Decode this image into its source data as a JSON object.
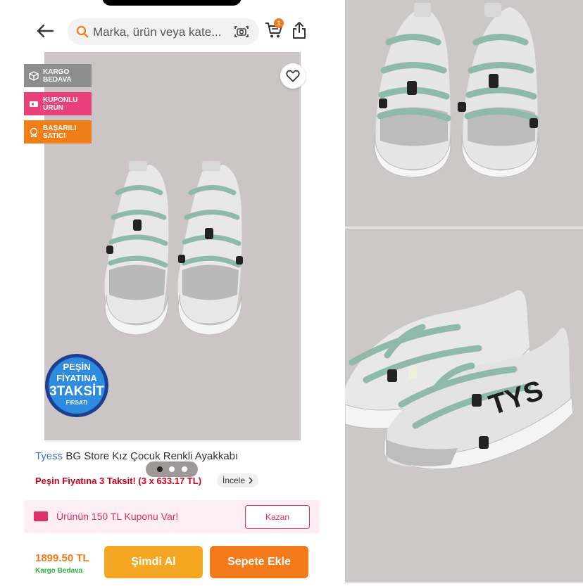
{
  "header": {
    "search_placeholder": "Marka, ürün veya kate...",
    "cart_count": "1"
  },
  "badges": [
    {
      "label": "KARGO BEDAVA",
      "color": "#8e8e8e",
      "icon": "box-icon"
    },
    {
      "label": "KUPONLU ÜRÜN",
      "color": "#e8407a",
      "icon": "ticket-icon"
    },
    {
      "label": "BAŞARILI SATICI",
      "color": "#f07f1a",
      "icon": "medal-icon"
    }
  ],
  "promo_sticker": {
    "line1": "PEŞİN",
    "line2": "FİYATINA",
    "line3": "3TAKSİT",
    "line4": "FIRSATI"
  },
  "gallery": {
    "total": 3,
    "active_index": 1
  },
  "product": {
    "brand": "Tyess",
    "name": " BG Store Kız Çocuk Renkli Ayakkabı",
    "installment_text": "Peşin Fiyatına 3 Taksit! (3 x 633.17 TL)",
    "incele_label": "İncele"
  },
  "coupon": {
    "text": "Ürünün 150 TL Kuponu Var!",
    "button": "Kazan"
  },
  "footer": {
    "price": "1899.50 TL",
    "shipping": "Kargo Bedava",
    "buy_now": "Şimdi Al",
    "add_to_cart": "Sepete Ekle"
  },
  "side_image_text": "TYS",
  "colors": {
    "accent": "#f27a1a",
    "buy_now": "#f5a623",
    "coupon_pink": "#e0306a",
    "installment_red": "#d0021b",
    "brand_blue": "#3c78c8",
    "shipping_green": "#2bb43a",
    "image_bg": "#cbc6c5"
  }
}
